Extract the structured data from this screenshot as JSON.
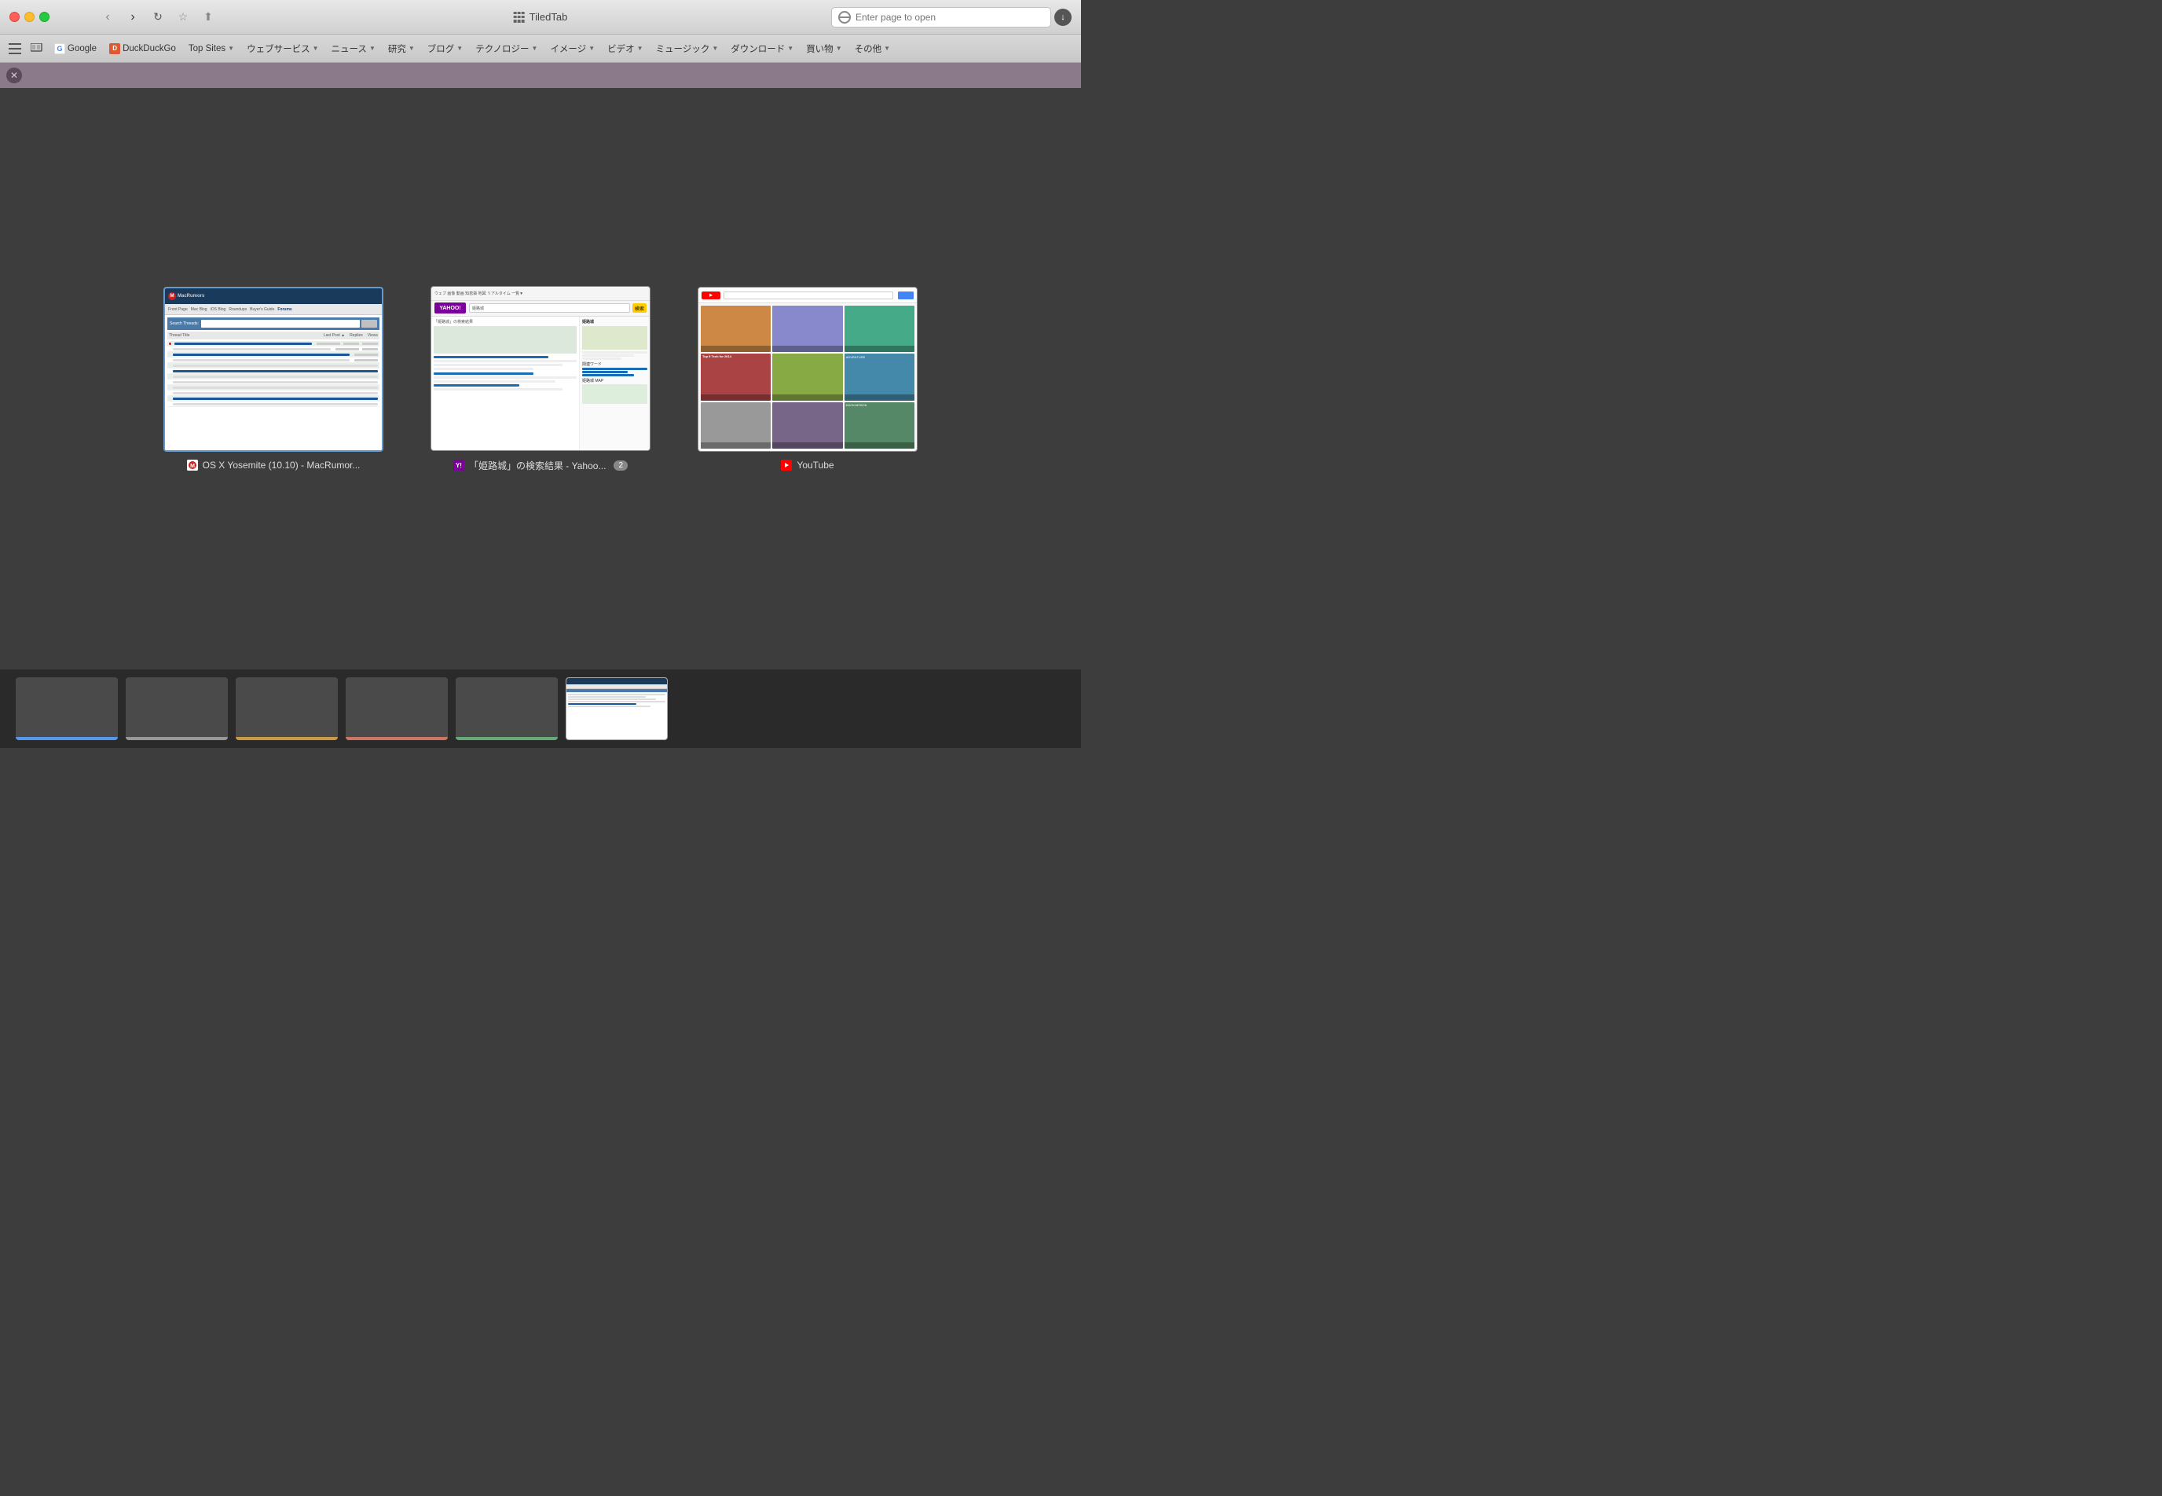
{
  "window": {
    "title": "TiledTab"
  },
  "titlebar": {
    "traffic_lights": {
      "close_label": "close",
      "minimize_label": "minimize",
      "maximize_label": "maximize"
    }
  },
  "search": {
    "placeholder": "Enter page to open"
  },
  "toolbar": {
    "bookmarks_icon": "📚",
    "reader_icon": "≡",
    "google_label": "Google",
    "ddg_label": "DuckDuckGo",
    "top_sites_label": "Top Sites",
    "web_services_label": "ウェブサービス",
    "news_label": "ニュース",
    "research_label": "研究",
    "blog_label": "ブログ",
    "technology_label": "テクノロジー",
    "image_label": "イメージ",
    "video_label": "ビデオ",
    "music_label": "ミュージック",
    "download_label": "ダウンロード",
    "shop_label": "買い物",
    "other_label": "その他"
  },
  "tabs": [
    {
      "id": "macrumors",
      "title": "OS X Yosemite (10.10) - MacRumor...",
      "favicon": "macrumors",
      "active": true
    },
    {
      "id": "yahoo",
      "title": "「姫路城」の検索結果 - Yahoo...",
      "favicon": "yahoo",
      "badge": "2",
      "active": false
    },
    {
      "id": "youtube",
      "title": "YouTube",
      "favicon": "youtube",
      "active": false
    }
  ],
  "bottom_tabs": [
    {
      "id": "tab1",
      "color": "blue",
      "active": false
    },
    {
      "id": "tab2",
      "color": "gray",
      "active": false
    },
    {
      "id": "tab3",
      "color": "orange",
      "active": false
    },
    {
      "id": "tab4",
      "color": "salmon",
      "active": false
    },
    {
      "id": "tab5",
      "color": "green",
      "active": false
    },
    {
      "id": "tab6",
      "color": "none",
      "active": true
    }
  ],
  "youtube_video_label": "Top 5 Tech for 2014"
}
